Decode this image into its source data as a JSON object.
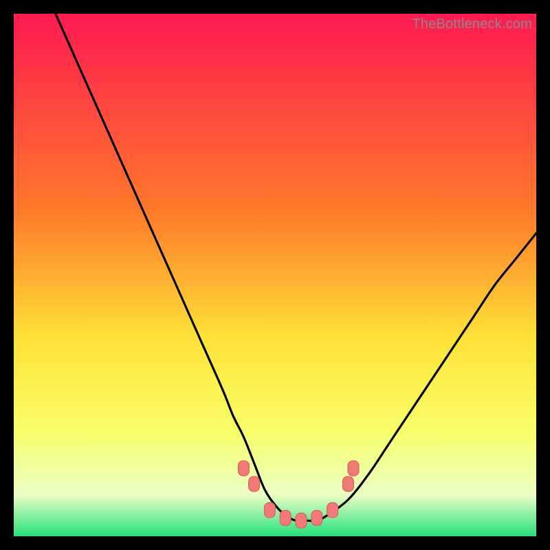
{
  "watermark": "TheBottleneck.com",
  "colors": {
    "gradient_top": "#ff1a52",
    "gradient_mid1": "#ff7a2a",
    "gradient_mid2": "#ffe238",
    "gradient_mid3": "#f8ff6a",
    "gradient_bottom_band": "#ecffc4",
    "gradient_bottom": "#26e07a",
    "curve": "#000000",
    "marker_fill": "#f07a76",
    "marker_stroke": "#d85a56"
  },
  "chart_data": {
    "type": "line",
    "title": "",
    "xlabel": "",
    "ylabel": "",
    "xlim": [
      0,
      100
    ],
    "ylim": [
      0,
      100
    ],
    "series": [
      {
        "name": "bottleneck-curve",
        "x": [
          8,
          12,
          16,
          20,
          24,
          28,
          32,
          36,
          40,
          42,
          44,
          46,
          48,
          50,
          52,
          54,
          56,
          58,
          60,
          64,
          68,
          72,
          76,
          80,
          84,
          88,
          92,
          96,
          100
        ],
        "y": [
          100,
          91,
          82,
          73,
          64,
          55,
          46,
          37,
          28,
          23,
          19,
          14,
          9,
          6,
          4,
          3,
          3,
          3,
          4,
          7,
          12,
          18,
          24,
          30,
          36,
          42,
          48,
          53,
          58
        ]
      }
    ],
    "markers": [
      {
        "x": 44,
        "y": 13
      },
      {
        "x": 46,
        "y": 10
      },
      {
        "x": 49,
        "y": 5
      },
      {
        "x": 52,
        "y": 3.5
      },
      {
        "x": 55,
        "y": 3
      },
      {
        "x": 58,
        "y": 3.5
      },
      {
        "x": 61,
        "y": 5
      },
      {
        "x": 64,
        "y": 10
      },
      {
        "x": 65,
        "y": 13
      }
    ]
  }
}
